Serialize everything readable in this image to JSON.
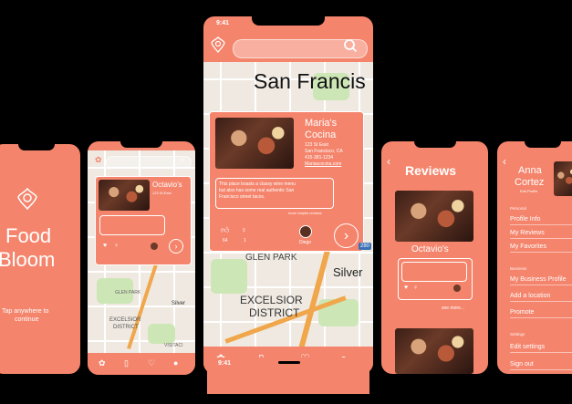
{
  "status_time": "9:41",
  "splash": {
    "title_line1": "Food",
    "title_line2": "Bloom",
    "tap_line1": "Tap anywhere to",
    "tap_line2": "continue"
  },
  "map_screen": {
    "city_label": "San Francis",
    "glen_park": "GLEN PARK",
    "silver": "Silver",
    "excelsior": "EXCELSIOR",
    "district": "DISTRICT",
    "highway": "280",
    "small_glen_park": "GLEN PARK",
    "small_silver": "Silver",
    "small_excelsior": "EXCELSIOR",
    "small_district": "DISTRICT",
    "small_visitacion": "VISITACI",
    "restaurant": {
      "name_line1": "Maria's",
      "name_line2": "Cocina",
      "address1": "123 St East",
      "address2": "San Francisco, CA",
      "phone": "415-381-1234",
      "website": "Mariascocina.com",
      "review_line1": "This place boasts a classy wine menu",
      "review_line2": "but also has some real authentic San",
      "review_line3": "Francisco street tacos.",
      "more": "more helpful reviews",
      "likes": "64",
      "ideas": "1",
      "reviewer": "Diego"
    },
    "small_card": {
      "name": "Octavio's",
      "info": "123 St East"
    }
  },
  "reviews_screen": {
    "title": "Reviews",
    "restaurant": "Octavio's",
    "see_more": "see more..."
  },
  "profile_screen": {
    "first_name": "Anna",
    "last_name": "Cortez",
    "edit": "Edit Profile",
    "personal_label": "Personal",
    "personal_items": [
      "Profile Info",
      "My Reviews",
      "My Favorites"
    ],
    "business_label": "Business",
    "business_items": [
      "My Business Profile",
      "Add a location",
      "Promote"
    ],
    "settings_label": "Settings",
    "settings_items": [
      "Edit settings",
      "Sign out"
    ]
  },
  "colors": {
    "brand": "#f4846c",
    "background": "#000000",
    "map_land": "#efe9e1",
    "map_park": "#cde6b6",
    "highway": "#f0a64b"
  }
}
